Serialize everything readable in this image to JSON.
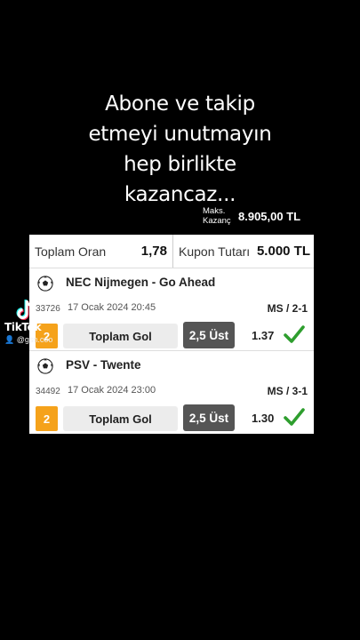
{
  "caption": {
    "lines": [
      "Abone ve takip",
      "etmeyi unutmayın",
      "hep birlikte",
      "kazancaz..."
    ]
  },
  "max_win": {
    "label_line1": "Maks.",
    "label_line2": "Kazanç",
    "value": "8.905,00 TL"
  },
  "summary": {
    "total_odds_label": "Toplam Oran",
    "total_odds_value": "1,78",
    "stake_label": "Kupon Tutarı",
    "stake_value": "5.000 TL"
  },
  "matches": [
    {
      "teams": "NEC Nijmegen - Go Ahead",
      "code": "33726",
      "date": "17 Ocak 2024 20:45",
      "result": "MS / 2-1",
      "order": "2",
      "market": "Toplam Gol",
      "pick": "2,5 Üst",
      "odd": "1.37",
      "status": "won",
      "icon": "soccer-ball-icon"
    },
    {
      "teams": "PSV - Twente",
      "code": "34492",
      "date": "17 Ocak 2024 23:00",
      "result": "MS / 3-1",
      "order": "2",
      "market": "Toplam Gol",
      "pick": "2,5 Üst",
      "odd": "1.30",
      "status": "won",
      "icon": "soccer-ball-icon"
    }
  ],
  "watermark": {
    "brand": "TikTok",
    "user": "@gsn.coo",
    "icon": "tiktok-logo-icon"
  },
  "colors": {
    "background": "#000000",
    "badge": "#f5a21b",
    "pick_bg": "#555555",
    "check": "#2e9e2e"
  }
}
